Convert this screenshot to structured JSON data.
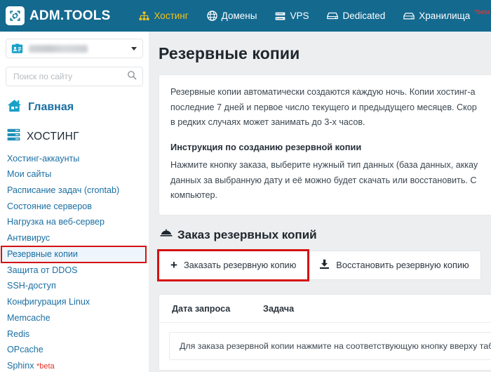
{
  "header": {
    "brand": "ADM.TOOLS",
    "brand_icon": "gear-logo-icon",
    "nav": [
      {
        "label": "Хостинг",
        "icon": "sitemap-icon",
        "active": true
      },
      {
        "label": "Домены",
        "icon": "globe-icon",
        "active": false
      },
      {
        "label": "VPS",
        "icon": "server-icon",
        "active": false
      },
      {
        "label": "Dedicated",
        "icon": "hdd-icon",
        "active": false
      },
      {
        "label": "Хранилища",
        "icon": "storage-icon",
        "active": false,
        "badge": "*beta"
      }
    ],
    "bg_color": "#14698f",
    "active_color": "#f5c518",
    "badge_color": "#e8312a"
  },
  "sidebar": {
    "account": {
      "icon": "id-card-icon",
      "value": "",
      "redacted": true,
      "caret": "chevron-down-icon"
    },
    "search": {
      "placeholder": "Поиск по сайту",
      "value": "",
      "icon": "search-icon"
    },
    "home": {
      "label": "Главная",
      "icon": "home-icon"
    },
    "section": {
      "label": "ХОСТИНГ",
      "icon": "server-stack-icon"
    },
    "items": [
      {
        "label": "Хостинг-аккаунты",
        "selected": false
      },
      {
        "label": "Мои сайты",
        "selected": false
      },
      {
        "label": "Расписание задач (crontab)",
        "selected": false
      },
      {
        "label": "Состояние серверов",
        "selected": false
      },
      {
        "label": "Нагрузка на веб-сервер",
        "selected": false
      },
      {
        "label": "Антивирус",
        "selected": false
      },
      {
        "label": "Резервные копии",
        "selected": true
      },
      {
        "label": "Защита от DDOS",
        "selected": false
      },
      {
        "label": "SSH-доступ",
        "selected": false
      },
      {
        "label": "Конфигурация Linux",
        "selected": false
      },
      {
        "label": "Memcache",
        "selected": false
      },
      {
        "label": "Redis",
        "selected": false
      },
      {
        "label": "OPcache",
        "selected": false
      },
      {
        "label": "Sphinx",
        "badge": "*beta",
        "selected": false
      }
    ],
    "link_color": "#1a6fa3",
    "highlight_color": "#d51111"
  },
  "main": {
    "title": "Резервные копии",
    "info": {
      "paragraph1_line1": "Резервные копии автоматически создаются каждую ночь. Копии хостинг-а",
      "paragraph1_line2": "последние 7 дней и первое число текущего и предыдущего месяцев. Скор",
      "paragraph1_line3": "в редких случаях может занимать до 3-х часов.",
      "heading": "Инструкция по созданию резервной копии",
      "paragraph2_line1": "Нажмите кнопку заказа, выберите нужный тип данных (база данных, аккау",
      "paragraph2_line2": "данных за выбранную дату и её можно будет скачать или восстановить. С",
      "paragraph2_line3": "компьютер."
    },
    "order_section": {
      "heading": "Заказ резервных копий",
      "heading_icon": "service-bell-icon",
      "order_button": {
        "label": "Заказать резервную копию",
        "icon": "plus-icon",
        "annotated": true
      },
      "restore_button": {
        "label": "Восстановить резервную копию",
        "icon": "download-icon",
        "annotated": false
      }
    },
    "table": {
      "columns": [
        "Дата запроса",
        "Задача"
      ],
      "empty_message": "Для заказа резервной копии нажмите на соответствующую кнопку вверху таблицы",
      "rows": []
    }
  }
}
